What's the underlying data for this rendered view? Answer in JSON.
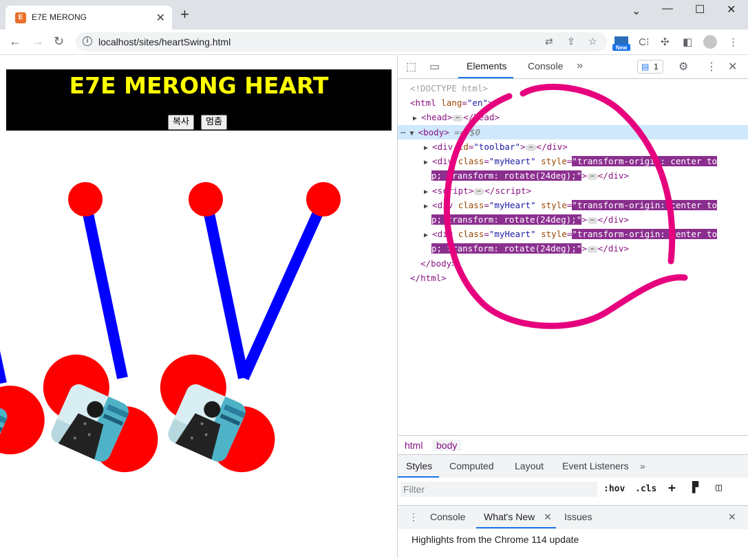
{
  "browser": {
    "tab_title": "E7E MERONG",
    "tab_favicon": "E",
    "url": "localhost/sites/heartSwing.html",
    "new_badge": "New",
    "window_controls": [
      "chevron-down-icon",
      "minimize-icon",
      "maximize-icon",
      "close-icon"
    ]
  },
  "page": {
    "title": "E7E MERONG HEART",
    "buttons": [
      "복사",
      "멈춤"
    ],
    "colors": {
      "banner_bg": "#000000",
      "title": "#ffff00",
      "stick": "#0000ff",
      "ball": "#ff0000",
      "heart": "#ff0000"
    }
  },
  "devtools": {
    "tabs": [
      "Elements",
      "Console"
    ],
    "active_tab": "Elements",
    "issue_count": "1",
    "dom": {
      "doctype": "<!DOCTYPE html>",
      "html_open_tag": "html",
      "html_attr_name": "lang",
      "html_attr_value": "\"en\"",
      "head_tag": "head",
      "body_tag": "body",
      "body_marker": "== $0",
      "toolbar_div_attr": "id",
      "toolbar_div_value": "\"toolbar\"",
      "heart_class_attr": "class",
      "heart_class_value": "\"myHeart\"",
      "style_attr": "style",
      "style_value_line1": "transform-origin: center to",
      "style_value_line2": "p; transform: rotate(24deg);",
      "script_tag": "script",
      "div_tag": "div"
    },
    "breadcrumbs": [
      "html",
      "body"
    ],
    "styles_tabs": [
      "Styles",
      "Computed",
      "Layout",
      "Event Listeners"
    ],
    "active_styles_tab": "Styles",
    "filter_placeholder": "Filter",
    "filter_buttons": [
      ":hov",
      ".cls"
    ],
    "drawer_tabs": [
      "Console",
      "What's New",
      "Issues"
    ],
    "active_drawer_tab": "What's New",
    "drawer_text": "Highlights from the Chrome 114 update"
  },
  "annotation": {
    "color": "#e6007e"
  }
}
